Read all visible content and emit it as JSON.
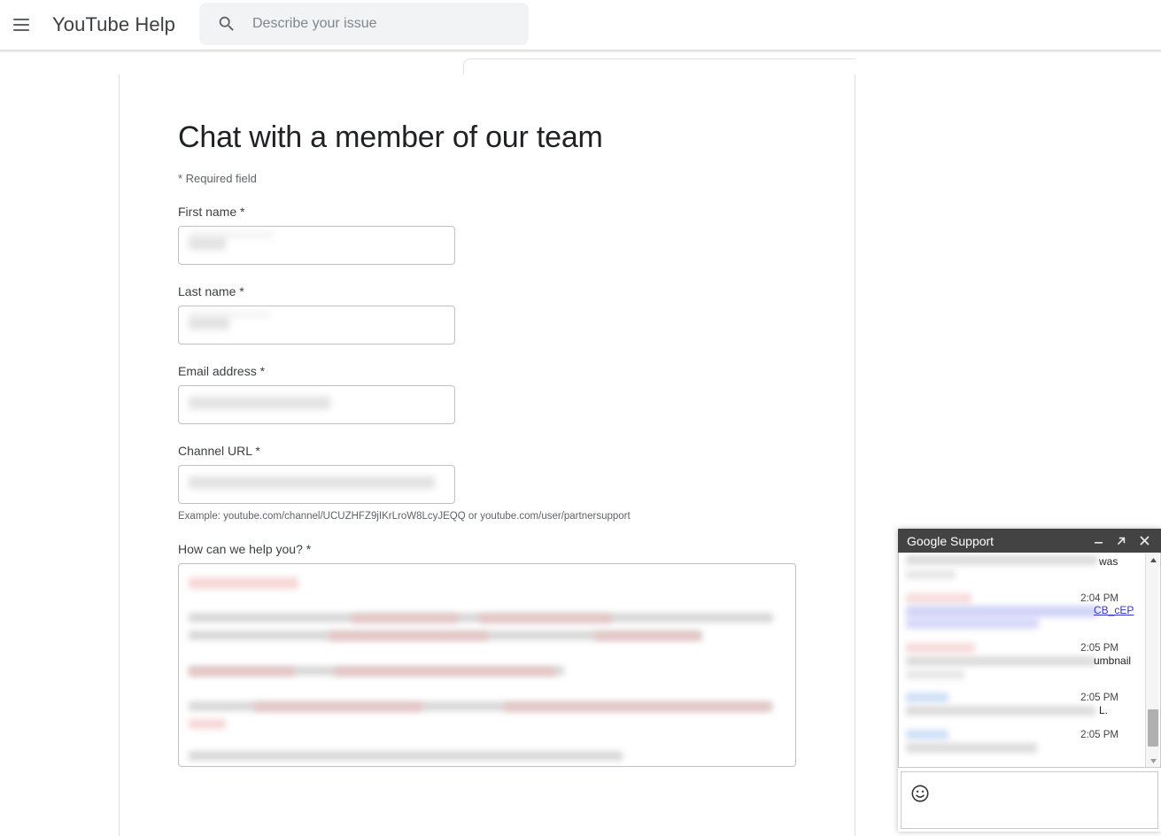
{
  "header": {
    "menu_icon": "hamburger-icon",
    "brand": "YouTube Help",
    "search": {
      "icon": "search-icon",
      "placeholder": "Describe your issue",
      "value": ""
    }
  },
  "form": {
    "title": "Chat with a member of our team",
    "required_note": "* Required field",
    "fields": [
      {
        "label": "First name *",
        "value": "",
        "redacted": true
      },
      {
        "label": "Last name *",
        "value": "",
        "redacted": true
      },
      {
        "label": "Email address *",
        "value": "",
        "redacted": true
      },
      {
        "label": "Channel URL *",
        "value": "",
        "redacted": true
      }
    ],
    "channel_hint": "Example: youtube.com/channel/UCUZHFZ9jIKrLroW8LcyJEQQ or youtube.com/user/partnersupport",
    "message_label": "How can we help you? *",
    "message_value": "",
    "message_redacted": true
  },
  "chat": {
    "title": "Google Support",
    "controls": [
      {
        "name": "minimize-button",
        "icon": "minimize-icon"
      },
      {
        "name": "expand-button",
        "icon": "expand-arrow-icon"
      },
      {
        "name": "close-button",
        "icon": "close-icon"
      }
    ],
    "messages": [
      {
        "id": 1,
        "redacted": true,
        "visible_tail": "was",
        "timestamp": ""
      },
      {
        "id": 2,
        "redacted": true,
        "visible_tail": "CB_cEP",
        "tail_is_link": true,
        "timestamp": "2:04 PM"
      },
      {
        "id": 3,
        "redacted": true,
        "visible_tail": "umbnail",
        "timestamp": "2:05 PM"
      },
      {
        "id": 4,
        "redacted": true,
        "visible_tail": "L.",
        "timestamp": "2:05 PM"
      },
      {
        "id": 5,
        "redacted": true,
        "visible_tail": "",
        "timestamp": "2:05 PM"
      }
    ],
    "scroll": {
      "up_icon": "scroll-up-arrow-icon",
      "down_icon": "scroll-down-arrow-icon"
    },
    "input": {
      "emoji_icon": "emoji-smiley-icon",
      "value": "",
      "placeholder": ""
    }
  },
  "colors": {
    "chat_header_bg": "#434343",
    "search_bg": "#f1f3f4",
    "link": "#3333cc",
    "text_primary": "#202124",
    "text_secondary": "#5f6368",
    "border": "#bdc1c6"
  }
}
